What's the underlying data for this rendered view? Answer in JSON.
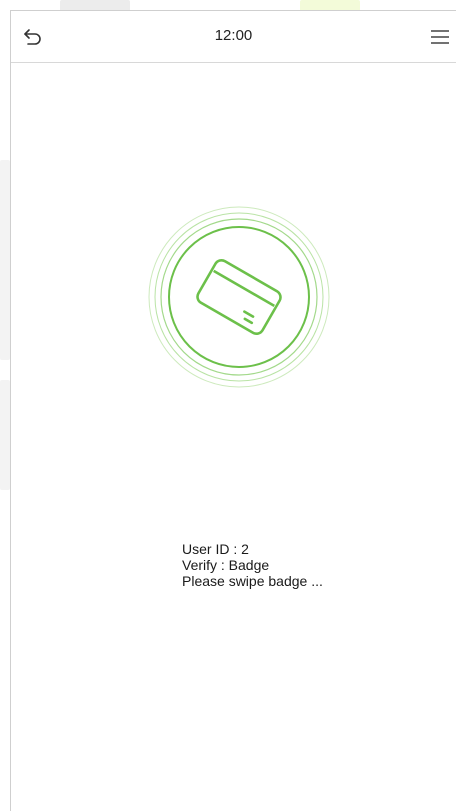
{
  "header": {
    "time": "12:00",
    "back_icon": "back-arrow-icon",
    "menu_icon": "hamburger-menu-icon"
  },
  "verification": {
    "icon": "badge-card-icon",
    "user_id_line": "User ID : 2",
    "verify_line": "Verify : Badge",
    "prompt_line": "Please swipe badge ..."
  },
  "colors": {
    "accent_green": "#6cc04a",
    "ring_light": "#b9e3a5",
    "divider": "#d8d8d8"
  }
}
